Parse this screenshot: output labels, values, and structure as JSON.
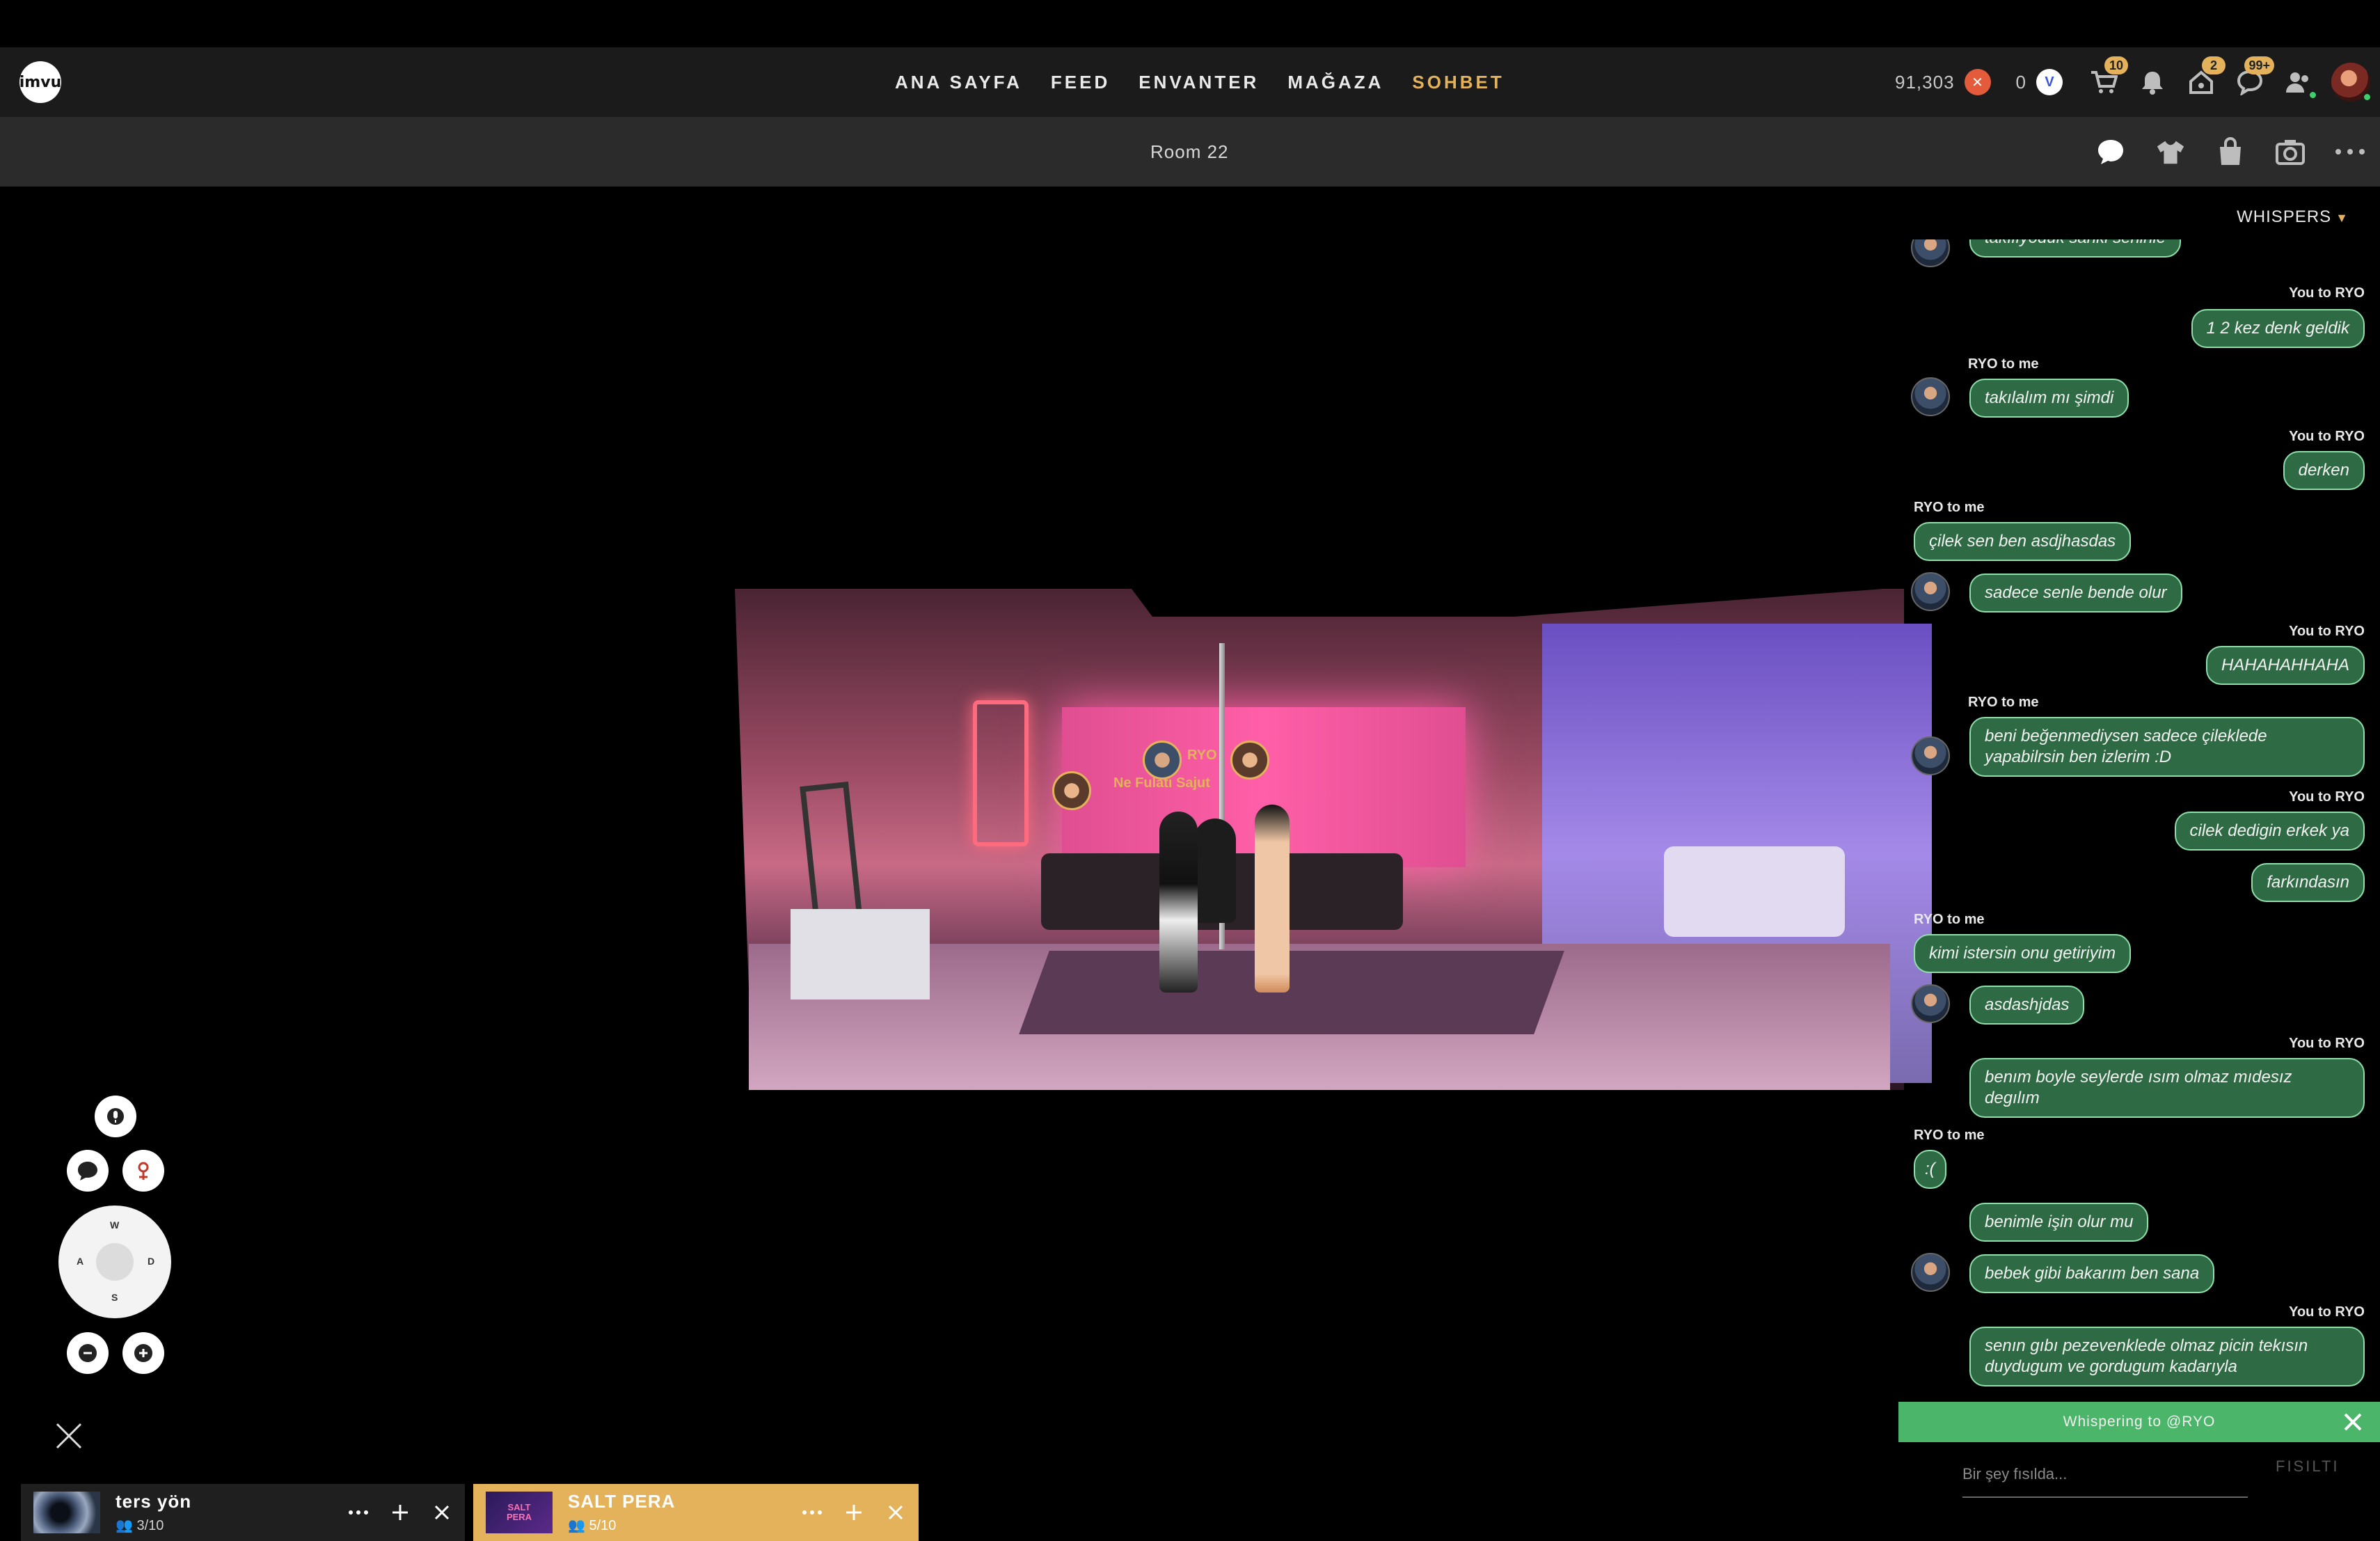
{
  "nav": {
    "logo": "imvu",
    "links": [
      "ANA SAYFA",
      "FEED",
      "ENVANTER",
      "MAĞAZA",
      "SOHBET"
    ],
    "active_index": 4
  },
  "stats": {
    "credits": "91,303",
    "vcoin": "0",
    "cart_badge": "10",
    "home_badge": "2",
    "messages_badge": "99+"
  },
  "room": {
    "title": "Room 22",
    "scene_tags": {
      "ryo_name": "RYO",
      "user_name": "Ne Fulatı Sajut"
    }
  },
  "chat": {
    "whispers_label": "WHISPERS",
    "messages": [
      {
        "dir": "in",
        "text": "takılıyoduk sanki seninle",
        "avatar": true
      },
      {
        "dir": "out",
        "sender": "You to RYO",
        "text": "1 2 kez denk geldik"
      },
      {
        "dir": "in",
        "sender": "RYO to me",
        "text": "takılalım mı şimdi",
        "avatar": true
      },
      {
        "dir": "out",
        "sender": "You to RYO",
        "text": "derken"
      },
      {
        "dir": "in",
        "sender": "RYO to me",
        "text": "çilek sen ben asdjhasdas"
      },
      {
        "dir": "in",
        "text": "sadece senle bende olur",
        "avatar": true
      },
      {
        "dir": "out",
        "sender": "You to RYO",
        "text": "HAHAHAHHAHA"
      },
      {
        "dir": "in",
        "sender": "RYO to me",
        "text": "beni beğenmediysen sadece çileklede yapabilrsin ben izlerim :D",
        "avatar": true
      },
      {
        "dir": "out",
        "sender": "You to RYO",
        "text": "cilek dedigin erkek ya"
      },
      {
        "dir": "out",
        "text": "farkındasın"
      },
      {
        "dir": "in",
        "sender": "RYO to me",
        "text": "kimi istersin onu getiriyim"
      },
      {
        "dir": "in",
        "text": "asdashjdas",
        "avatar": true
      },
      {
        "dir": "out",
        "sender": "You to RYO",
        "text": "benım boyle seylerde ısım olmaz mıdesız degılım"
      },
      {
        "dir": "in",
        "sender": "RYO to me",
        "text": ":("
      },
      {
        "dir": "in",
        "text": "benimle işin olur mu"
      },
      {
        "dir": "in",
        "text": "bebek gibi bakarım ben sana",
        "avatar": true
      },
      {
        "dir": "out",
        "sender": "You to RYO",
        "text": "senın gıbı pezevenklede olmaz picin tekısın duydugum ve gordugum kadarıyla"
      }
    ],
    "whispering_to": "Whispering to @RYO",
    "input_placeholder": "Bir şey fısılda...",
    "send_label": "FISILTI"
  },
  "controls": {
    "dpad": {
      "up": "W",
      "left": "A",
      "right": "D",
      "down": "S"
    }
  },
  "tabs": [
    {
      "name": "ters yön",
      "count": "3/10"
    },
    {
      "name": "SALT PERA",
      "count": "5/10",
      "thumb_text": "SALT PERA"
    }
  ]
}
